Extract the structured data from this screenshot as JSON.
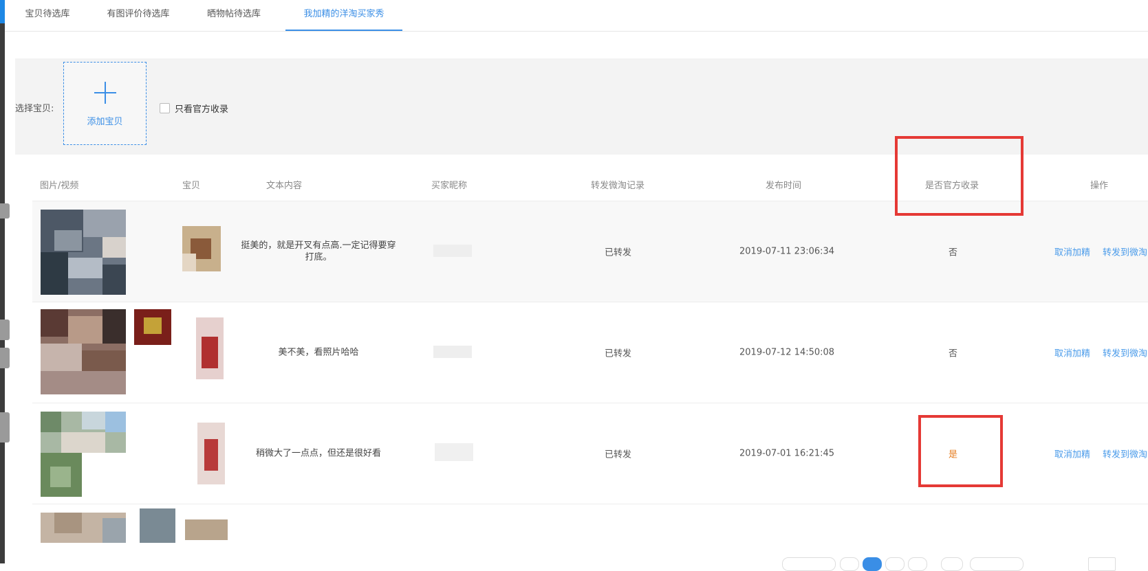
{
  "tabs": [
    {
      "label": "宝贝待选库",
      "active": false
    },
    {
      "label": "有图评价待选库",
      "active": false
    },
    {
      "label": "晒物帖待选库",
      "active": false
    },
    {
      "label": "我加精的洋淘买家秀",
      "active": true
    }
  ],
  "filter": {
    "select_label": "选择宝贝:",
    "add_button_label": "添加宝贝",
    "official_only_label": "只看官方收录"
  },
  "table": {
    "headers": [
      "图片/视频",
      "宝贝",
      "文本内容",
      "买家昵称",
      "转发微淘记录",
      "发布时间",
      "是否官方收录",
      "操作"
    ],
    "rows": [
      {
        "text": "挺美的，就是开叉有点高.一定记得要穿打底。",
        "forward": "已转发",
        "time": "2019-07-11 23:06:34",
        "official": "否",
        "op1": "取消加精",
        "op2": "转发到微淘"
      },
      {
        "text": "美不美，看照片哈哈",
        "forward": "已转发",
        "time": "2019-07-12 14:50:08",
        "official": "否",
        "op1": "取消加精",
        "op2": "转发到微淘"
      },
      {
        "text": "稍微大了一点点，但还是很好看",
        "forward": "已转发",
        "time": "2019-07-01 16:21:45",
        "official": "是",
        "op1": "取消加精",
        "op2": "转发到微淘"
      }
    ]
  },
  "colors": {
    "accent": "#3a8ee6",
    "highlight_box": "#e53935",
    "official_yes": "#e67e22"
  }
}
